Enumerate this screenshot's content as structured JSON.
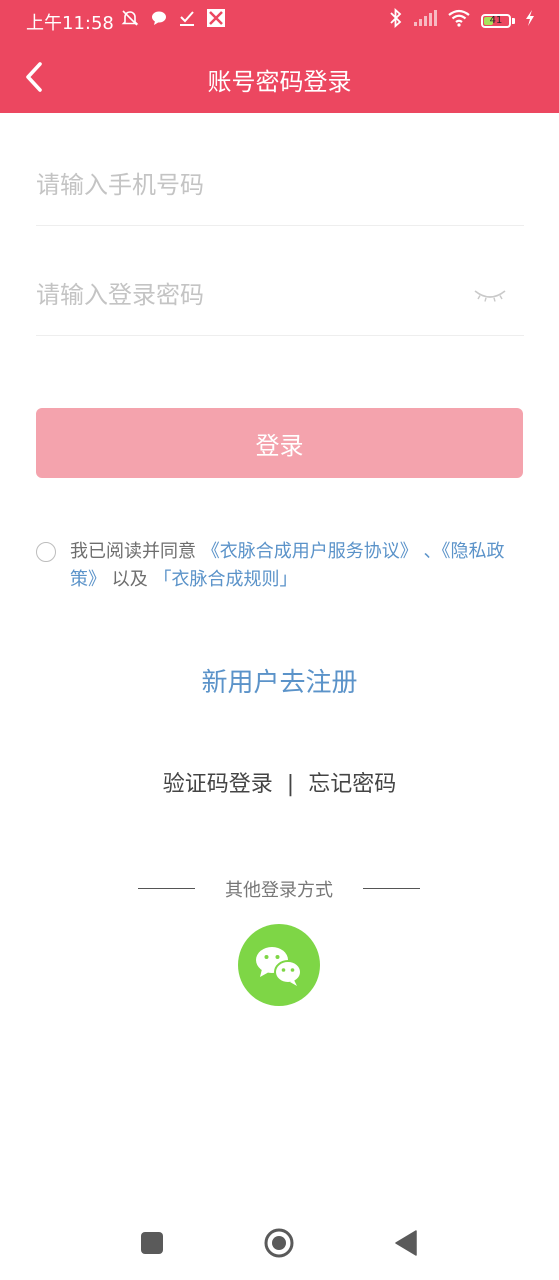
{
  "status_bar": {
    "time": "上午11:58",
    "battery_level": "41",
    "icons": [
      "mute-bell-icon",
      "chat-bubble-icon",
      "download-check-icon",
      "app-icon",
      "bluetooth-icon",
      "signal-icon",
      "wifi-icon",
      "battery-icon",
      "charging-icon"
    ]
  },
  "header": {
    "title": "账号密码登录",
    "background": "#ec4760"
  },
  "form": {
    "phone_placeholder": "请输入手机号码",
    "phone_value": "",
    "password_placeholder": "请输入登录密码",
    "password_value": "",
    "login_label": "登录",
    "login_button_color": "#f4a3ad"
  },
  "agreement": {
    "prefix": "我已阅读并同意",
    "link1": "《衣脉合成用户服务协议》",
    "mid": "、",
    "link2": "《隐私政策》",
    "and": "以及",
    "link3": "「衣脉合成规则」",
    "checked": false,
    "link_color": "#5b93c9"
  },
  "register": {
    "label": "新用户去注册"
  },
  "alt_login": {
    "code_login": "验证码登录",
    "separator": "|",
    "forgot_password": "忘记密码"
  },
  "other": {
    "label": "其他登录方式",
    "wechat_color": "#7ed646"
  }
}
